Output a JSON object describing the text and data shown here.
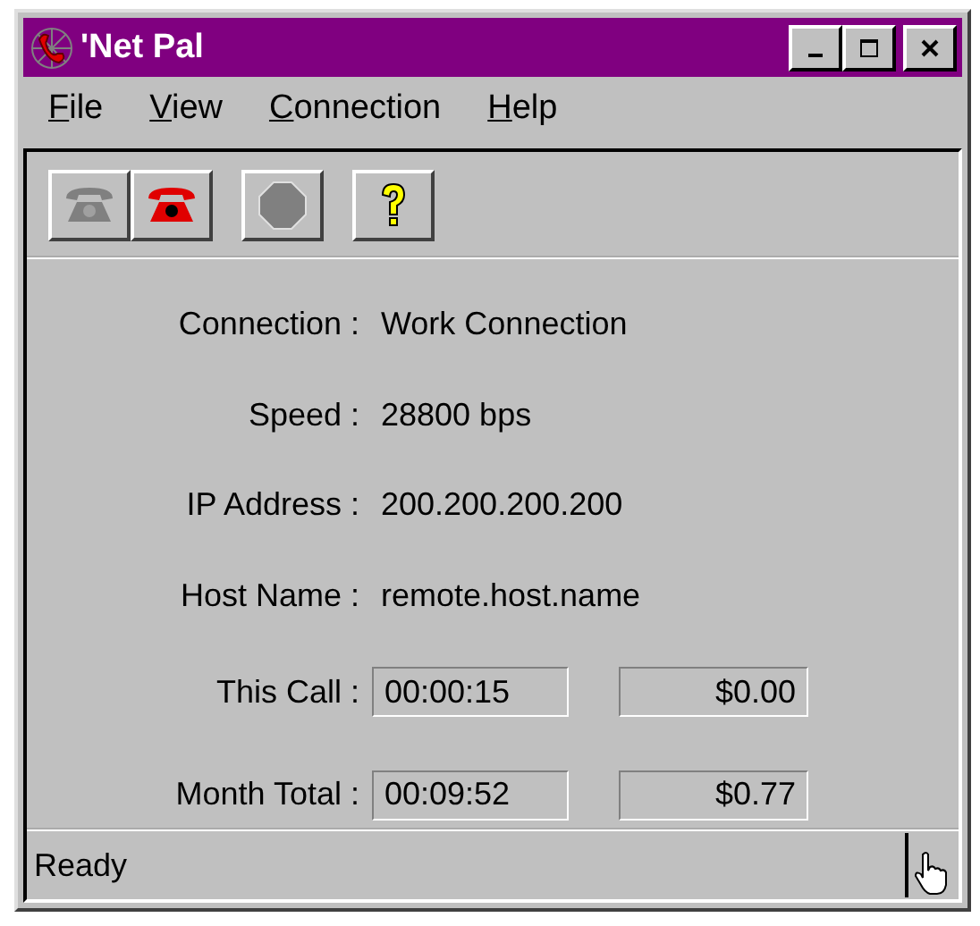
{
  "window": {
    "title": "'Net Pal"
  },
  "title_buttons": [
    {
      "kind": "minimize"
    },
    {
      "kind": "maximize"
    },
    {
      "kind": "close"
    }
  ],
  "menu": [
    {
      "label": "File"
    },
    {
      "label": "View"
    },
    {
      "label": "Connection"
    },
    {
      "label": "Help"
    }
  ],
  "toolbar": [
    {
      "kind": "dial",
      "disabled": true
    },
    {
      "kind": "hangup",
      "disabled": false
    },
    {
      "kind": "stop",
      "disabled": true
    },
    {
      "kind": "help",
      "disabled": false
    }
  ],
  "info": [
    {
      "label": "Connection :",
      "value": "Work Connection"
    },
    {
      "label": "Speed :",
      "value": "28800 bps"
    },
    {
      "label": "IP Address :",
      "value": "200.200.200.200"
    },
    {
      "label": "Host Name :",
      "value": "remote.host.name"
    }
  ],
  "totals": [
    {
      "label": "This Call :",
      "time": "00:00:15",
      "cost": "$0.00"
    },
    {
      "label": "Month Total :",
      "time": "00:09:52",
      "cost": "$0.77"
    }
  ],
  "status_bar": {
    "text": "Ready"
  }
}
